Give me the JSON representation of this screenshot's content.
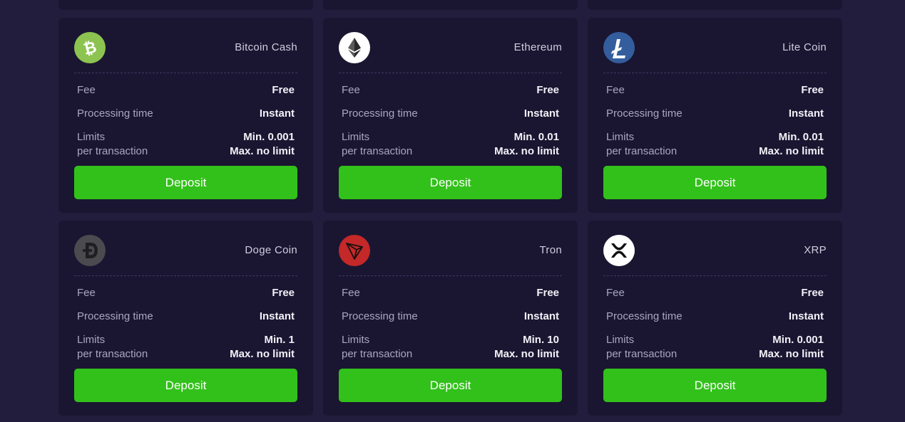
{
  "colors": {
    "page_bg": "#221d3c",
    "card_bg": "#1a1631",
    "deposit_green": "#32c11a"
  },
  "labels": {
    "fee": "Fee",
    "processing_time": "Processing time",
    "limits": "Limits",
    "per_transaction": "per transaction",
    "deposit": "Deposit"
  },
  "coins": [
    {
      "name": "Bitcoin Cash",
      "icon": "bitcoin-cash-icon",
      "icon_color": "#8dc351",
      "fee": "Free",
      "processing_time": "Instant",
      "min": "Min. 0.001",
      "max": "Max. no limit"
    },
    {
      "name": "Ethereum",
      "icon": "ethereum-icon",
      "icon_color": "#ffffff",
      "fee": "Free",
      "processing_time": "Instant",
      "min": "Min. 0.01",
      "max": "Max. no limit"
    },
    {
      "name": "Lite Coin",
      "icon": "litecoin-icon",
      "icon_color": "#345d9d",
      "fee": "Free",
      "processing_time": "Instant",
      "min": "Min. 0.01",
      "max": "Max. no limit"
    },
    {
      "name": "Doge Coin",
      "icon": "dogecoin-icon",
      "icon_color": "#4a4a4f",
      "fee": "Free",
      "processing_time": "Instant",
      "min": "Min. 1",
      "max": "Max. no limit"
    },
    {
      "name": "Tron",
      "icon": "tron-icon",
      "icon_color": "#c42828",
      "fee": "Free",
      "processing_time": "Instant",
      "min": "Min. 10",
      "max": "Max. no limit"
    },
    {
      "name": "XRP",
      "icon": "xrp-icon",
      "icon_color": "#ffffff",
      "fee": "Free",
      "processing_time": "Instant",
      "min": "Min. 0.001",
      "max": "Max. no limit"
    }
  ]
}
